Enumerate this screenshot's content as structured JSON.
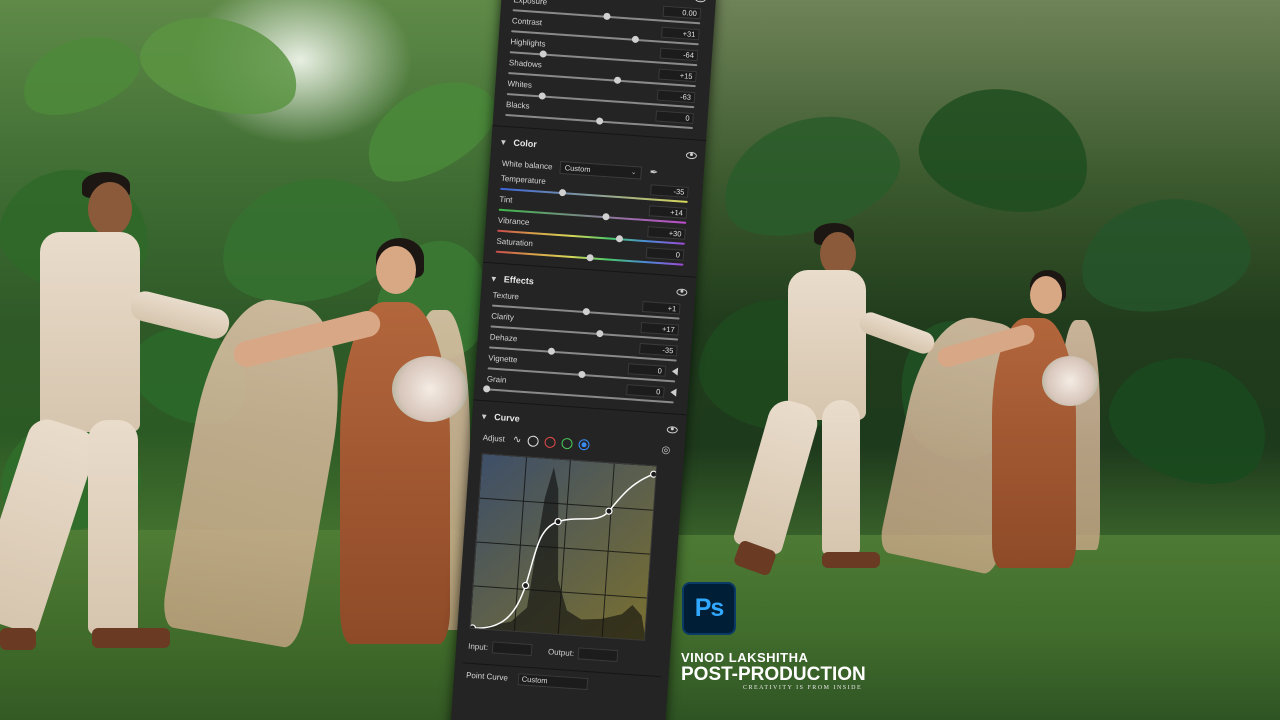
{
  "basic": {
    "sliders": [
      {
        "label": "Exposure",
        "value": "0.00",
        "pos": 0.5
      },
      {
        "label": "Contrast",
        "value": "+31",
        "pos": 0.66
      },
      {
        "label": "Highlights",
        "value": "-64",
        "pos": 0.18
      },
      {
        "label": "Shadows",
        "value": "+15",
        "pos": 0.58
      },
      {
        "label": "Whites",
        "value": "-63",
        "pos": 0.19
      },
      {
        "label": "Blacks",
        "value": "0",
        "pos": 0.5
      }
    ]
  },
  "color": {
    "title": "Color",
    "wb_label": "White balance",
    "wb_value": "Custom",
    "sliders": [
      {
        "label": "Temperature",
        "value": "-35",
        "pos": 0.33
      },
      {
        "label": "Tint",
        "value": "+14",
        "pos": 0.57
      },
      {
        "label": "Vibrance",
        "value": "+30",
        "pos": 0.65
      },
      {
        "label": "Saturation",
        "value": "0",
        "pos": 0.5
      }
    ]
  },
  "effects": {
    "title": "Effects",
    "sliders": [
      {
        "label": "Texture",
        "value": "+1",
        "pos": 0.5
      },
      {
        "label": "Clarity",
        "value": "+17",
        "pos": 0.58
      },
      {
        "label": "Dehaze",
        "value": "-35",
        "pos": 0.33
      },
      {
        "label": "Vignette",
        "value": "0",
        "pos": 0.5
      },
      {
        "label": "Grain",
        "value": "0",
        "pos": 0.0
      }
    ]
  },
  "curve": {
    "title": "Curve",
    "adjust_label": "Adjust",
    "input_label": "Input:",
    "output_label": "Output:",
    "point_curve_label": "Point Curve",
    "point_curve_value": "Custom"
  },
  "branding": {
    "ps_logo": "Ps",
    "name": "VINOD LAKSHITHA",
    "title": "POST-PRODUCTION",
    "tagline": "CREATIVITY IS FROM INSIDE"
  }
}
